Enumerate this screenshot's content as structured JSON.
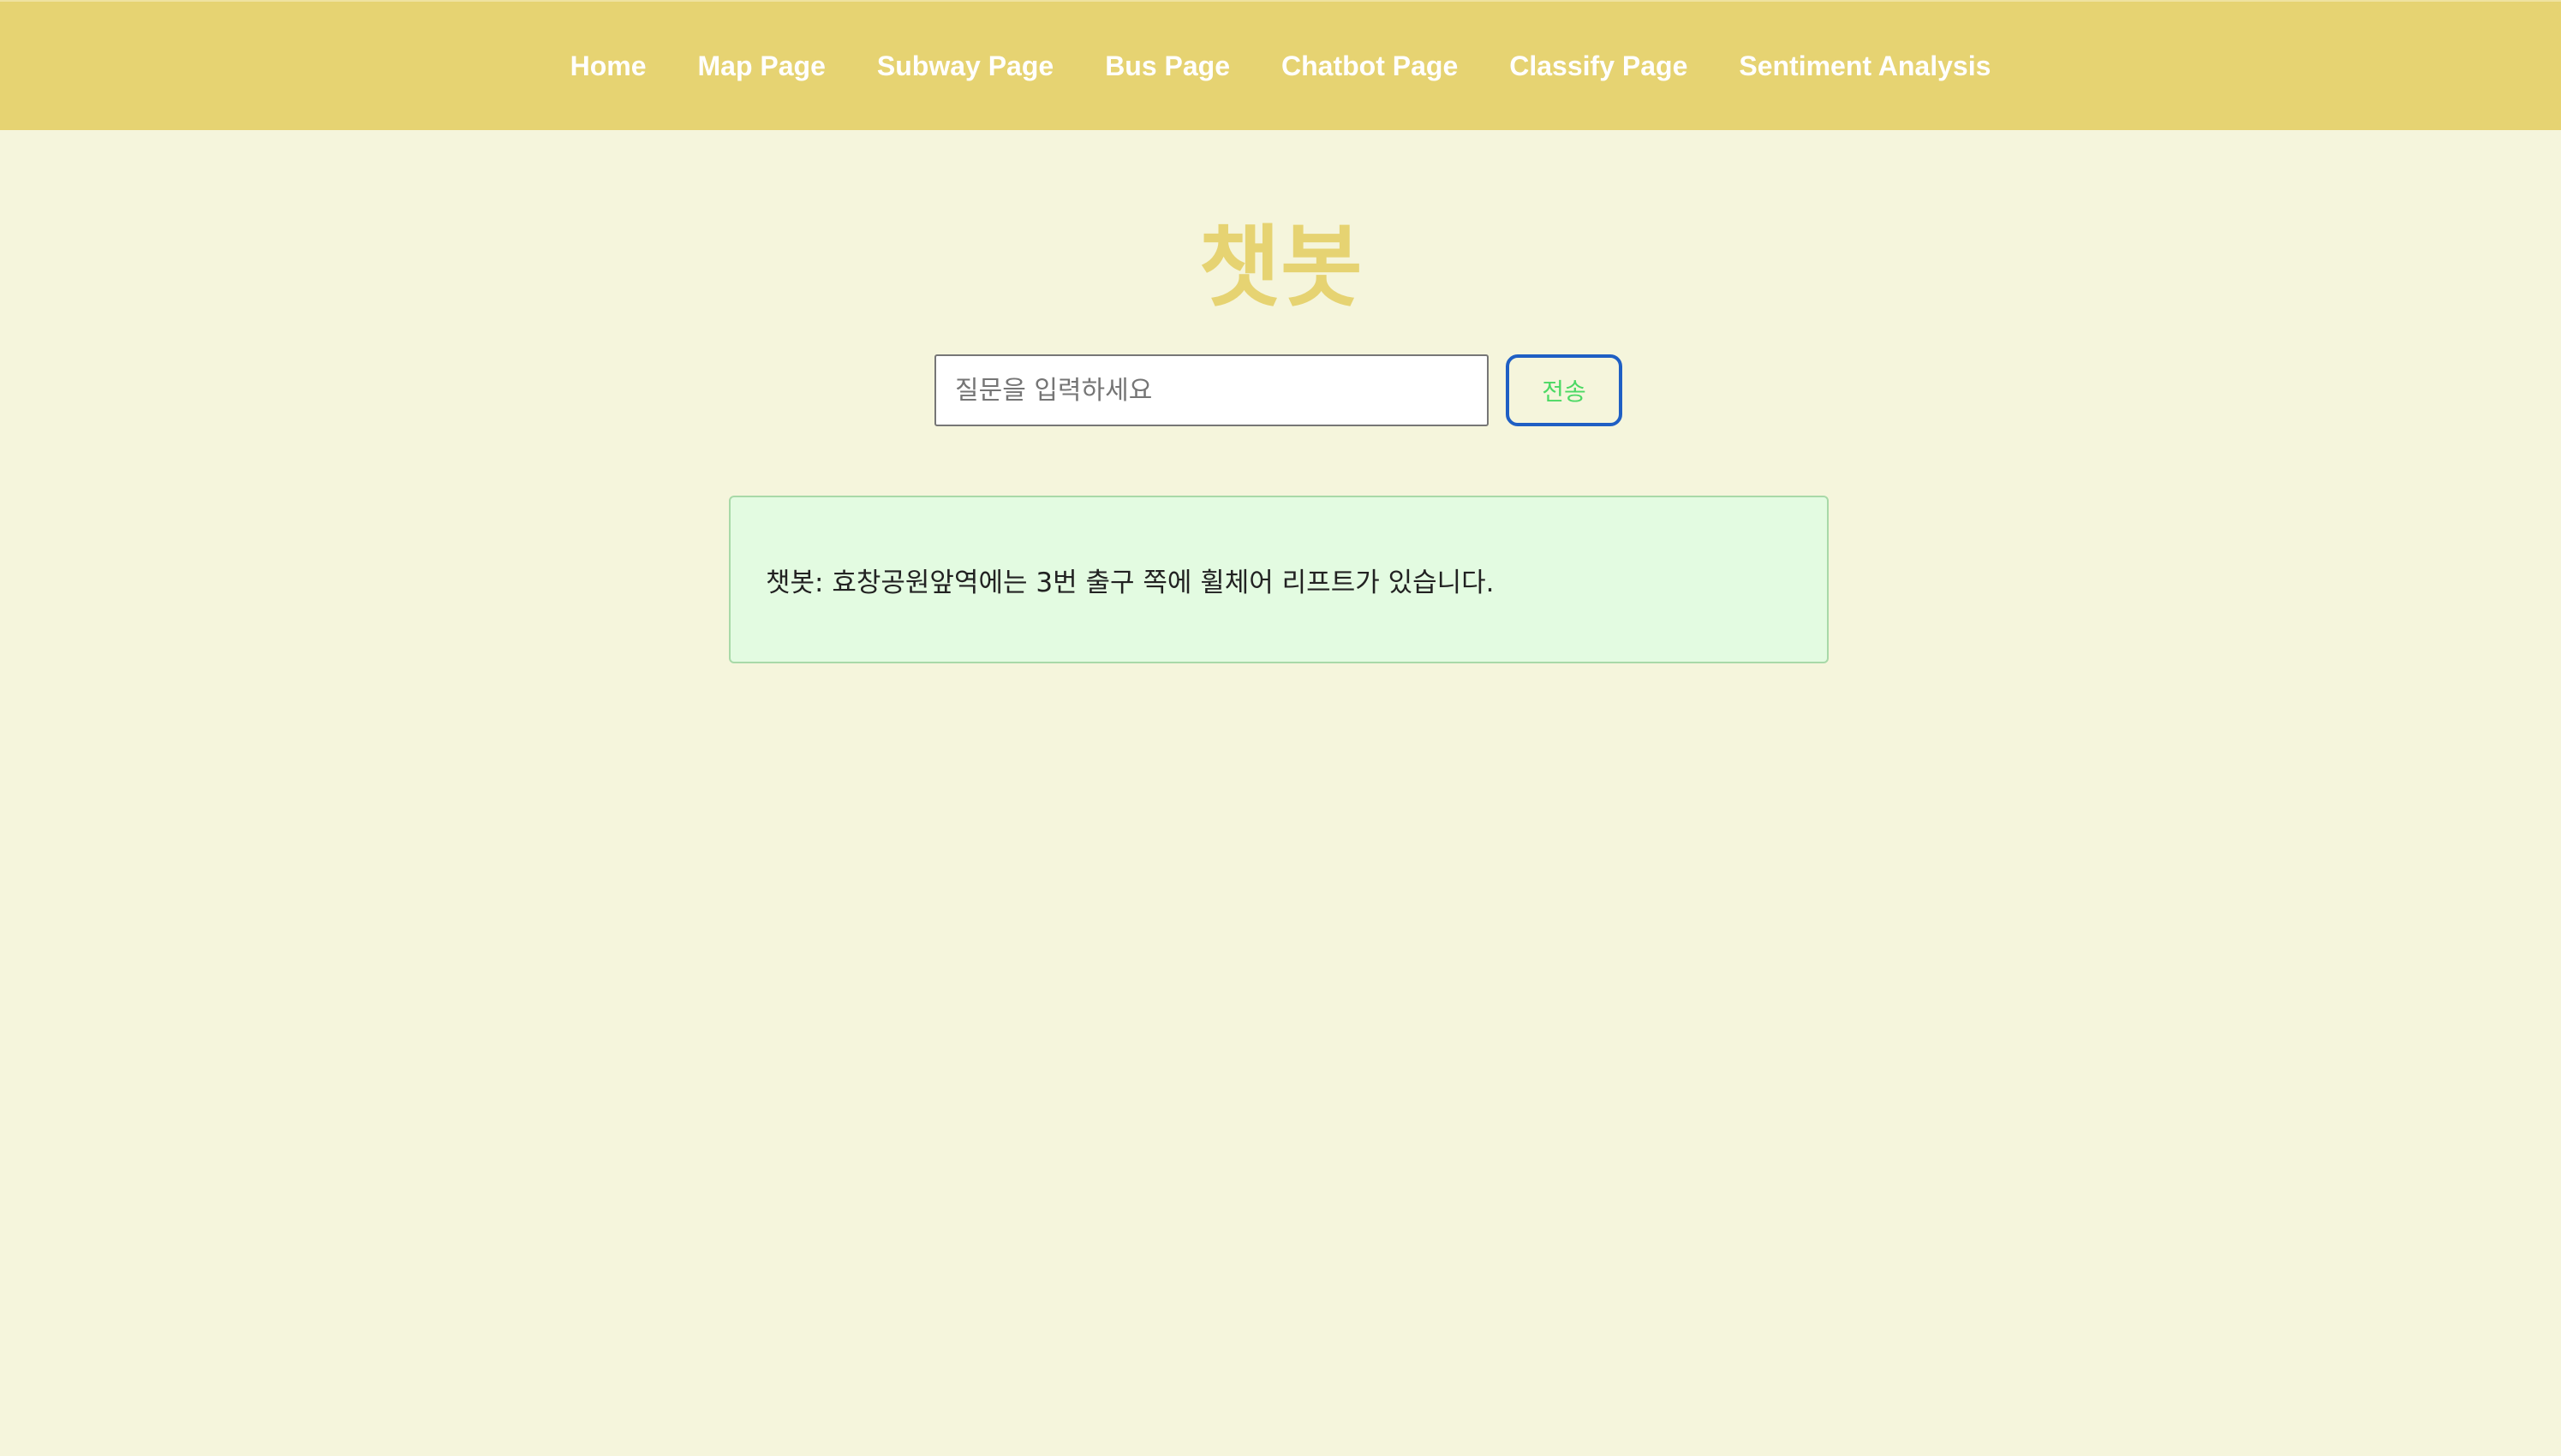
{
  "nav": {
    "items": [
      {
        "label": "Home"
      },
      {
        "label": "Map Page"
      },
      {
        "label": "Subway Page"
      },
      {
        "label": "Bus Page"
      },
      {
        "label": "Chatbot Page"
      },
      {
        "label": "Classify Page"
      },
      {
        "label": "Sentiment Analysis"
      }
    ]
  },
  "page": {
    "title": "챗봇"
  },
  "form": {
    "input_placeholder": "질문을 입력하세요",
    "input_value": "",
    "send_label": "전송"
  },
  "response": {
    "text": "챗봇: 효창공원앞역에는 3번 출구 쪽에 휠체어 리프트가 있습니다."
  },
  "colors": {
    "navbar": "#e6d372",
    "background": "#f5f5dc",
    "title": "#e6d372",
    "send_text": "#4cd964",
    "send_border": "#1f5fc4",
    "response_bg": "#e3fbe1",
    "response_border": "#a8d9a8"
  }
}
